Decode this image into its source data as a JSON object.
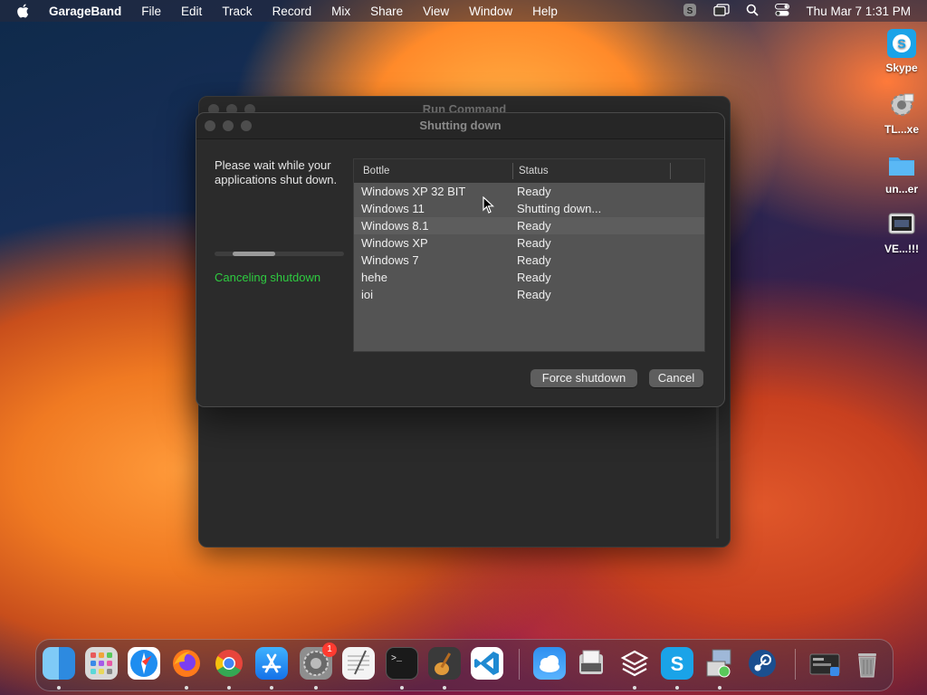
{
  "menubar": {
    "app_name": "GarageBand",
    "items": [
      "File",
      "Edit",
      "Track",
      "Record",
      "Mix",
      "Share",
      "View",
      "Window",
      "Help"
    ],
    "clock": "Thu Mar 7  1:31 PM"
  },
  "back_window": {
    "title": "Run Command"
  },
  "dialog": {
    "title": "Shutting down",
    "message": "Please wait while your applications shut down.",
    "progress_fraction": 0.33,
    "status_text": "Canceling shutdown",
    "table": {
      "headers": [
        "Bottle",
        "Status"
      ],
      "rows": [
        {
          "bottle": "Windows XP 32 BIT",
          "status": "Ready"
        },
        {
          "bottle": "Windows 11",
          "status": "Shutting down..."
        },
        {
          "bottle": "Windows 8.1",
          "status": "Ready"
        },
        {
          "bottle": "Windows XP",
          "status": "Ready"
        },
        {
          "bottle": "Windows 7",
          "status": "Ready"
        },
        {
          "bottle": "hehe",
          "status": "Ready"
        },
        {
          "bottle": "ioi",
          "status": "Ready"
        }
      ]
    },
    "force_label": "Force shutdown",
    "cancel_label": "Cancel"
  },
  "desktop_icons": [
    {
      "label": "Skype",
      "icon": "skype-icon"
    },
    {
      "label": "TL...xe",
      "icon": "gear-icon"
    },
    {
      "label": "un...er",
      "icon": "folder-icon"
    },
    {
      "label": "VE...!!!",
      "icon": "video-icon"
    }
  ],
  "dock": {
    "apps": [
      "Finder",
      "Launchpad",
      "Safari",
      "Firefox",
      "Chrome",
      "App Store",
      "System Settings",
      "TextEdit",
      "Terminal",
      "GarageBand",
      "VS Code",
      "Weather",
      "Preview",
      "Apps",
      "Skype",
      "Installer",
      "Steam",
      "Screenshot",
      "Trash"
    ],
    "settings_badge": "1"
  }
}
